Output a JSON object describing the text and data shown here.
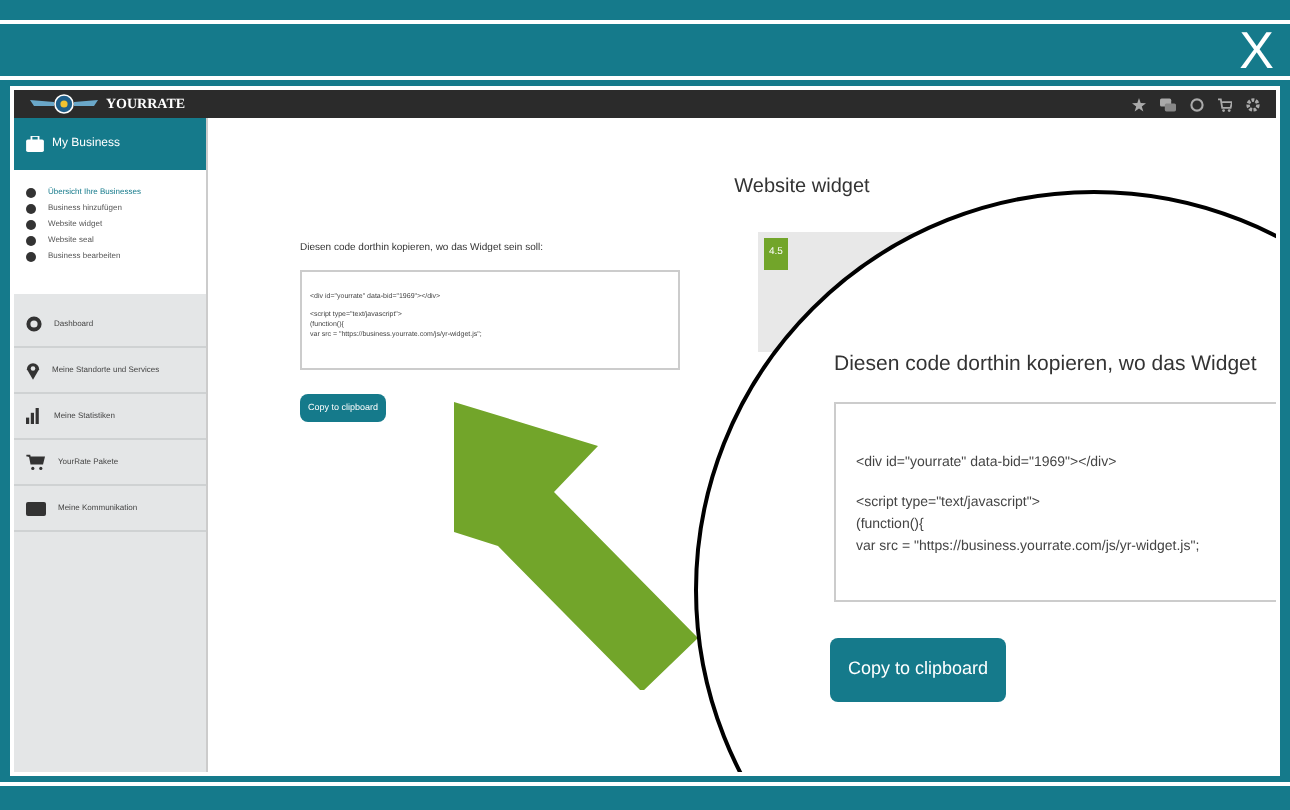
{
  "top_bar": {
    "close": "X"
  },
  "app_header": {
    "logo": "YOURRATE"
  },
  "sidebar": {
    "section": {
      "label": "My Business",
      "expanded": true
    },
    "sub_items": [
      {
        "label": "Übersicht Ihre Businesses",
        "selected": true
      },
      {
        "label": "Business hinzufügen",
        "selected": false
      },
      {
        "label": "Website widget",
        "selected": false
      },
      {
        "label": "Website seal",
        "selected": false
      },
      {
        "label": "Business bearbeiten",
        "selected": false
      }
    ],
    "items": [
      {
        "label": "Dashboard"
      },
      {
        "label": "Meine Standorte und Services"
      },
      {
        "label": "Meine Statistiken"
      },
      {
        "label": "YourRate Pakete"
      },
      {
        "label": "Meine Kommunikation"
      }
    ]
  },
  "main": {
    "title": "Website widget",
    "instruction": "Diesen code dorthin kopieren, wo das Widget sein soll:",
    "code_blocks": [
      [
        "<div id=\"yourrate\" data-bid=\"1969\"></div>"
      ],
      [
        "<script type=\"text/javascript\">",
        "(function(){",
        "var src = \"https://business.yourrate.com/js/yr-widget.js\";"
      ]
    ],
    "copy_button": "Copy to clipboard",
    "widget_preview": {
      "rating": "4.5"
    }
  },
  "magnifier": {
    "instruction": "Diesen code dorthin kopieren, wo das Widget",
    "code_blocks": [
      [
        "<div id=\"yourrate\" data-bid=\"1969\"></div>"
      ],
      [
        "<script type=\"text/javascript\">",
        "(function(){",
        "var src = \"https://business.yourrate.com/js/yr-widget.js\";"
      ]
    ],
    "copy_button": "Copy to clipboard"
  }
}
